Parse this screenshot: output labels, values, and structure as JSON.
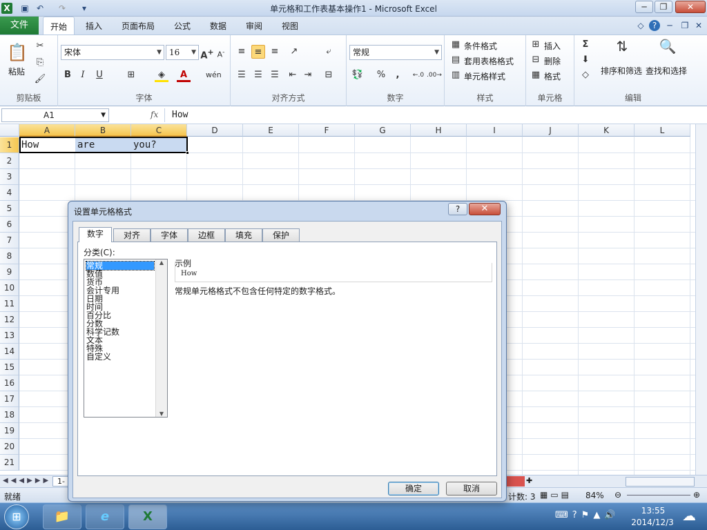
{
  "window": {
    "title": "单元格和工作表基本操作1 - Microsoft Excel"
  },
  "ribbon_tabs": [
    "文件",
    "开始",
    "插入",
    "页面布局",
    "公式",
    "数据",
    "审阅",
    "视图"
  ],
  "ribbon": {
    "clipboard": {
      "label": "剪贴板",
      "paste": "粘贴"
    },
    "font": {
      "label": "字体",
      "name": "宋体",
      "size": "16",
      "bold": "B",
      "italic": "I",
      "underline": "U"
    },
    "alignment": {
      "label": "对齐方式"
    },
    "number": {
      "label": "数字",
      "format": "常规",
      "percent": "%",
      "comma": ","
    },
    "styles": {
      "label": "样式",
      "conditional": "条件格式",
      "table": "套用表格格式",
      "cell_styles": "单元格样式"
    },
    "cells": {
      "label": "单元格",
      "insert": "插入",
      "delete": "删除",
      "format": "格式"
    },
    "editing": {
      "label": "编辑",
      "sort": "排序和筛选",
      "find": "查找和选择",
      "sigma": "Σ"
    }
  },
  "formula_bar": {
    "name_box": "A1",
    "fx": "fx",
    "value": "How"
  },
  "grid": {
    "columns": [
      "A",
      "B",
      "C",
      "D",
      "E",
      "F",
      "G",
      "H",
      "I",
      "J",
      "K",
      "L"
    ],
    "rows": [
      "1",
      "2",
      "3",
      "4",
      "5",
      "6",
      "7",
      "8",
      "9",
      "10",
      "11",
      "12",
      "13",
      "14",
      "15",
      "16",
      "17",
      "18",
      "19",
      "20",
      "21"
    ],
    "cells": {
      "A1": "How",
      "B1": "are",
      "C1": "you?"
    }
  },
  "sheet_tab": "1-",
  "status": {
    "ready": "就绪",
    "count": "计数: 3",
    "zoom": "84%"
  },
  "taskbar": {
    "time": "13:55",
    "date": "2014/12/3"
  },
  "dialog": {
    "title": "设置单元格格式",
    "help": "?",
    "close": "✕",
    "tabs": [
      "数字",
      "对齐",
      "字体",
      "边框",
      "填充",
      "保护"
    ],
    "category_label": "分类(C):",
    "categories": [
      "常规",
      "数值",
      "货币",
      "会计专用",
      "日期",
      "时间",
      "百分比",
      "分数",
      "科学记数",
      "文本",
      "特殊",
      "自定义"
    ],
    "sample_label": "示例",
    "sample_value": "How",
    "description": "常规单元格格式不包含任何特定的数字格式。",
    "ok": "确定",
    "cancel": "取消"
  }
}
